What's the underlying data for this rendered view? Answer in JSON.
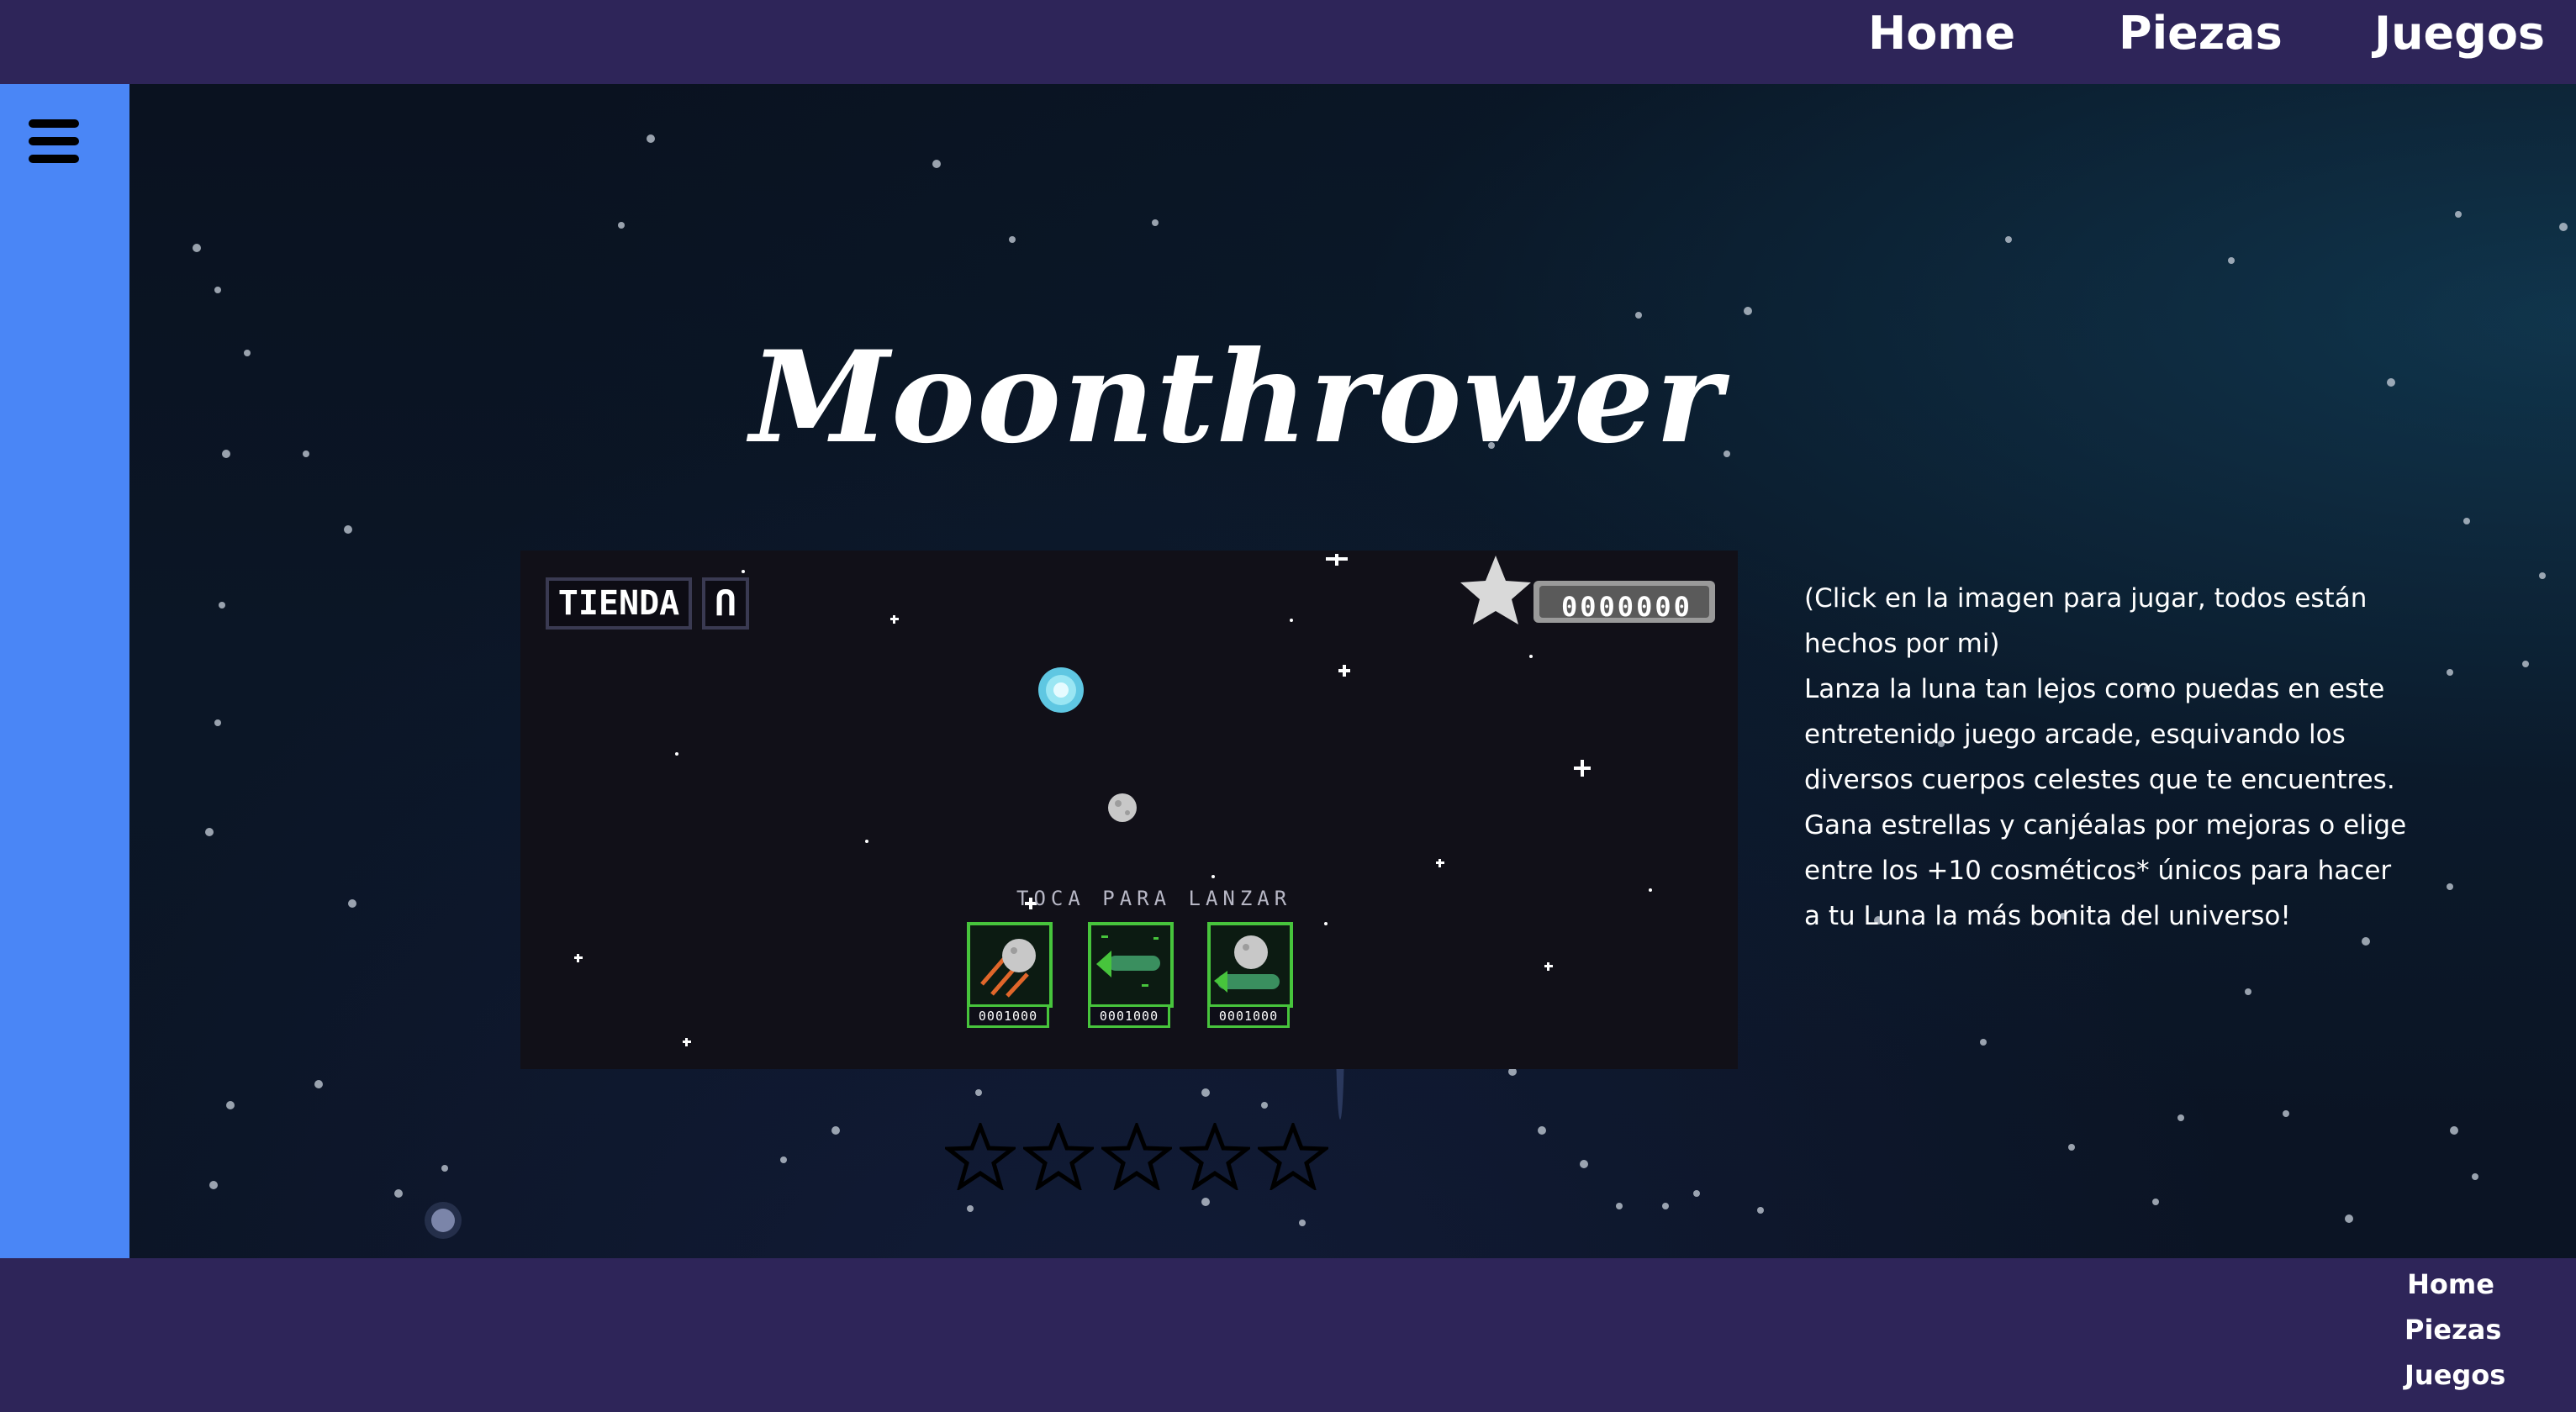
{
  "nav": {
    "home": "Home",
    "piezas": "Piezas",
    "juegos": "Juegos"
  },
  "sidebar": {
    "menu_icon": "hamburger-menu-icon"
  },
  "main": {
    "title": "Moonthrower",
    "game": {
      "store_label": "TIENDA",
      "store_icon_label": "Ո",
      "score": "0000000",
      "tap_prompt": "TOCA PARA LANZAR",
      "cards": [
        {
          "icon": "moon-meteor-card-icon",
          "price": "0001000"
        },
        {
          "icon": "green-comet-card-icon",
          "price": "0001000"
        },
        {
          "icon": "moon-green-trail-card-icon",
          "price": "0001000"
        }
      ]
    },
    "description": {
      "line1": "(Click en la imagen para jugar, todos están hechos por mi)",
      "line2": "Lanza la luna tan lejos como puedas en este entretenido juego arcade, esquivando los diversos cuerpos celestes que te encuentres. Gana estrellas y canjéalas por mejoras o elige entre los +10 cosméticos* únicos para hacer a tu Luna la más bonita del universo!"
    },
    "rating": {
      "value": 0,
      "max": 5
    }
  },
  "footer": {
    "home": "Home",
    "piezas": "Piezas",
    "juegos": "Juegos"
  },
  "colors": {
    "nav_bg": "#2e2559",
    "sidebar_bg": "#4a86f6",
    "card_border": "#47c43c"
  }
}
